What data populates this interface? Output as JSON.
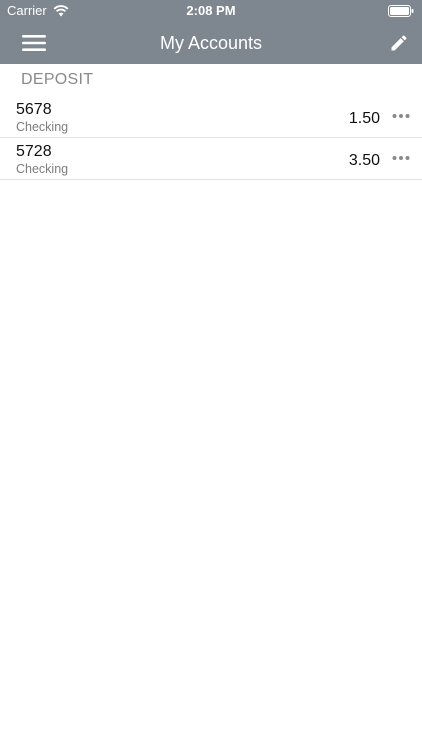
{
  "status_bar": {
    "carrier": "Carrier",
    "time": "2:08 PM",
    "icons": [
      "wifi-icon",
      "battery-icon"
    ]
  },
  "nav": {
    "title": "My Accounts",
    "left_icon": "hamburger-menu-icon",
    "right_icon": "pencil-edit-icon",
    "background_color": "#7e868f"
  },
  "section": {
    "header": "DEPOSIT"
  },
  "accounts": [
    {
      "number": "5678",
      "type": "Checking",
      "balance": "1.50"
    },
    {
      "number": "5728",
      "type": "Checking",
      "balance": "3.50"
    }
  ]
}
